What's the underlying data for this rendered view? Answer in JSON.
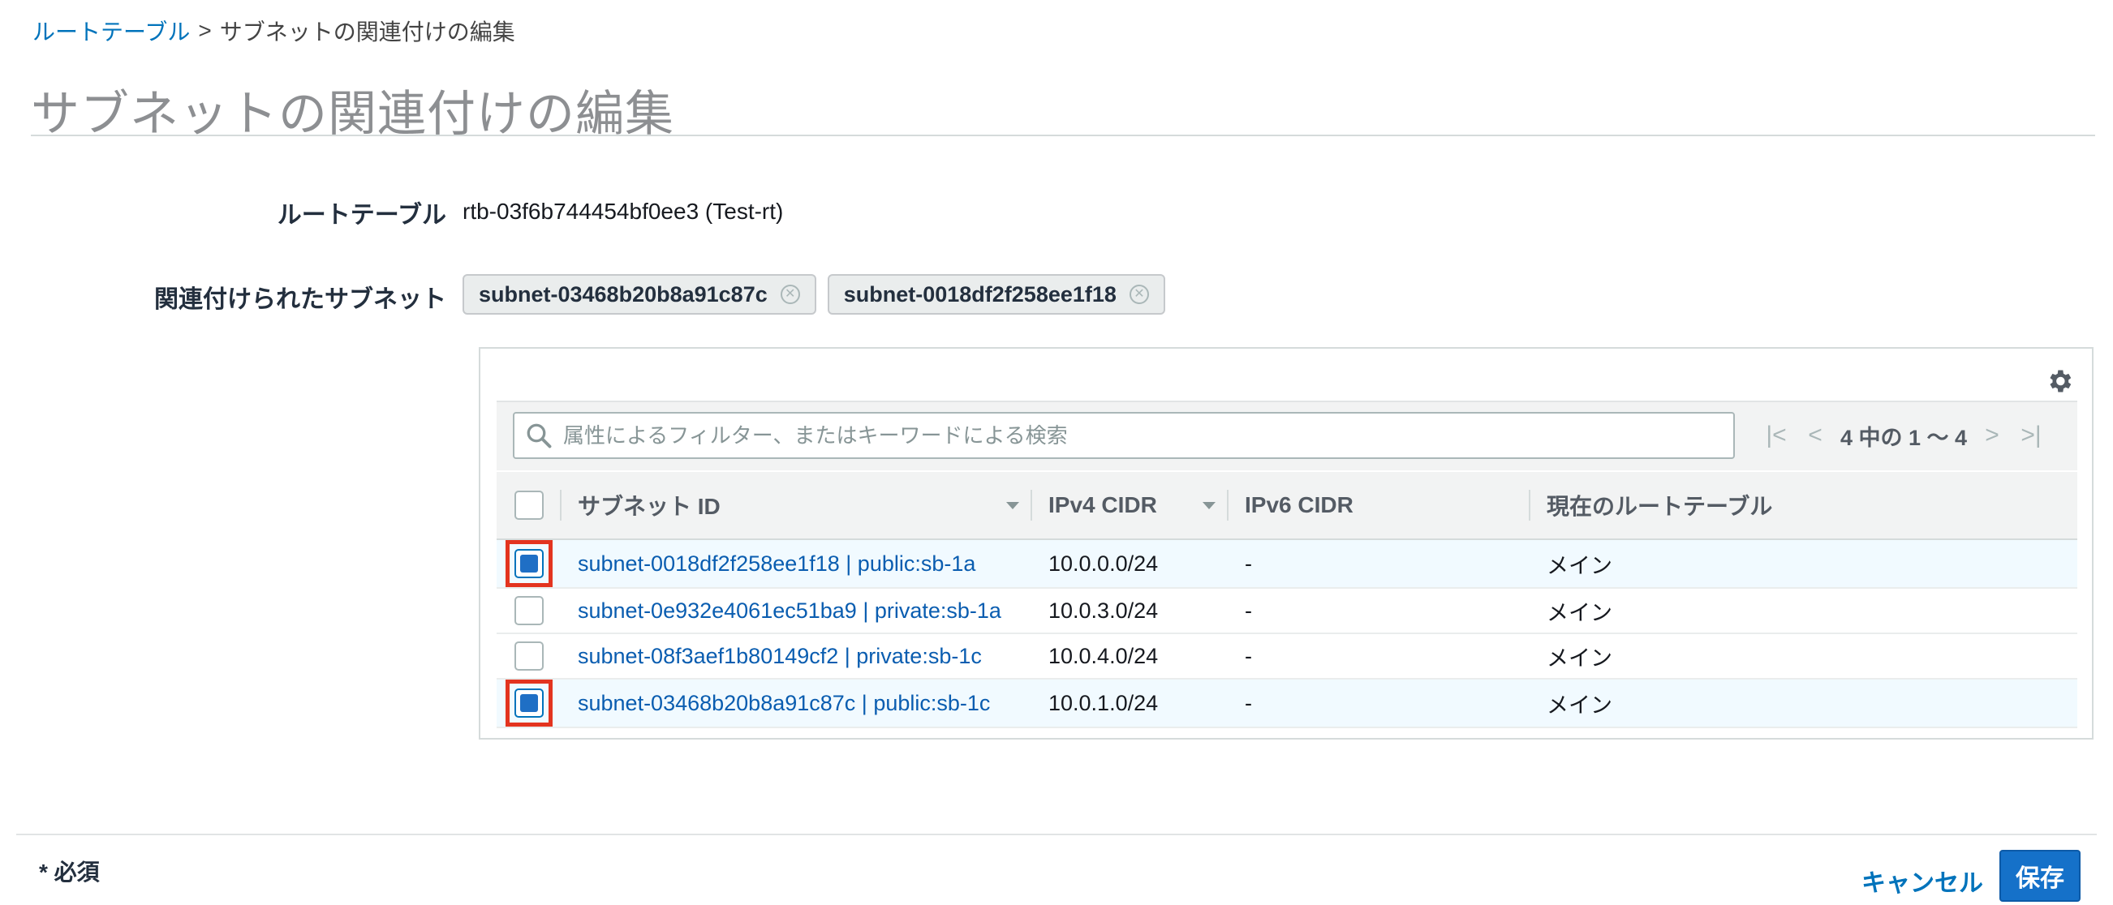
{
  "breadcrumb": {
    "parent": "ルートテーブル",
    "separator": ">",
    "current": "サブネットの関連付けの編集"
  },
  "page_title": "サブネットの関連付けの編集",
  "route_table": {
    "label": "ルートテーブル",
    "value": "rtb-03f6b744454bf0ee3 (Test-rt)"
  },
  "associated_subnets": {
    "label": "関連付けられたサブネット",
    "tokens": [
      "subnet-03468b20b8a91c87c",
      "subnet-0018df2f258ee1f18"
    ]
  },
  "icons": {
    "settings": "gear-icon",
    "search": "search-icon",
    "first_page": "first-page-icon",
    "prev_page": "previous-page-icon",
    "next_page": "next-page-icon",
    "last_page": "last-page-icon",
    "remove_token": "remove-token-icon"
  },
  "filter": {
    "placeholder": "属性によるフィルター、またはキーワードによる検索",
    "value": ""
  },
  "pagination": {
    "summary": "4 中の 1 〜 4"
  },
  "table": {
    "columns": {
      "subnet_id": "サブネット ID",
      "ipv4": "IPv4 CIDR",
      "ipv6": "IPv6 CIDR",
      "route_table": "現在のルートテーブル"
    },
    "rows": [
      {
        "checked": true,
        "subnet": "subnet-0018df2f258ee1f18 | public:sb-1a",
        "ipv4": "10.0.0.0/24",
        "ipv6": "-",
        "route_table": "メイン"
      },
      {
        "checked": false,
        "subnet": "subnet-0e932e4061ec51ba9 | private:sb-1a",
        "ipv4": "10.0.3.0/24",
        "ipv6": "-",
        "route_table": "メイン"
      },
      {
        "checked": false,
        "subnet": "subnet-08f3aef1b80149cf2 | private:sb-1c",
        "ipv4": "10.0.4.0/24",
        "ipv6": "-",
        "route_table": "メイン"
      },
      {
        "checked": true,
        "subnet": "subnet-03468b20b8a91c87c | public:sb-1c",
        "ipv4": "10.0.1.0/24",
        "ipv6": "-",
        "route_table": "メイン"
      }
    ]
  },
  "footer": {
    "required_note": "* 必須",
    "cancel_label": "キャンセル",
    "save_label": "保存"
  },
  "colors": {
    "link": "#0073bb",
    "selected_row": "#f1faff",
    "highlight_box": "#e3341f",
    "primary_button": "#1571c9"
  }
}
